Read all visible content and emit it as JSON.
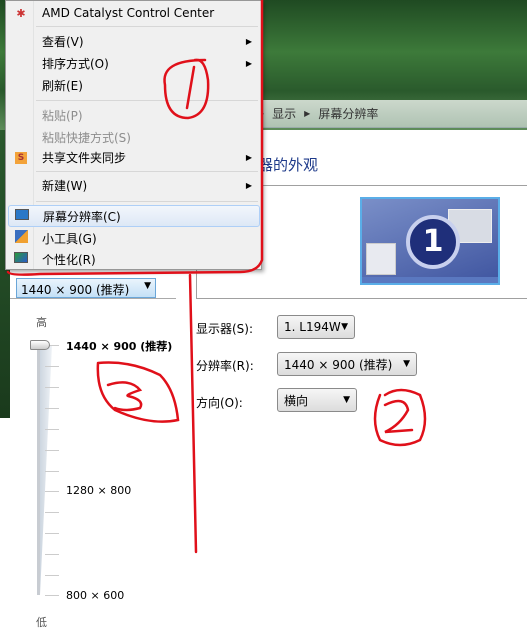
{
  "context_menu": {
    "items": [
      {
        "label": "AMD Catalyst Control Center",
        "icon": "amd-icon"
      },
      {
        "label": "查看(V)",
        "submenu": true
      },
      {
        "label": "排序方式(O)",
        "submenu": true
      },
      {
        "label": "刷新(E)"
      },
      {
        "label": "粘贴(P)",
        "disabled": true
      },
      {
        "label": "粘贴快捷方式(S)",
        "disabled": true
      },
      {
        "label": "共享文件夹同步",
        "submenu": true,
        "icon": "sync-s-icon"
      },
      {
        "label": "新建(W)",
        "submenu": true
      },
      {
        "label": "屏幕分辨率(C)",
        "icon": "monitor-icon",
        "highlighted": true
      },
      {
        "label": "小工具(G)",
        "icon": "gadgets-icon"
      },
      {
        "label": "个性化(R)",
        "icon": "personalize-icon"
      }
    ]
  },
  "breadcrumb": [
    "显示",
    "屏幕分辨率"
  ],
  "heading": "器的外观",
  "preview": {
    "monitor_number": "1"
  },
  "settings": {
    "display_label": "显示器(S):",
    "display_value": "1. L194W",
    "resolution_label": "分辨率(R):",
    "resolution_value": "1440 × 900 (推荐)",
    "orientation_label": "方向(O):",
    "orientation_value": "横向"
  },
  "resolution_dropdown": {
    "value": "1440 × 900 (推荐)",
    "high": "高",
    "low": "低",
    "marks": [
      "1440 × 900 (推荐)",
      "1280 × 800",
      "800 × 600"
    ],
    "slider_position": "1440 × 900 (推荐)"
  },
  "annotations": [
    "1",
    "2",
    "3"
  ],
  "colors": {
    "heading": "#1e3a8a",
    "annotation": "#e0101a",
    "menu_highlight": "#dde8f6"
  }
}
